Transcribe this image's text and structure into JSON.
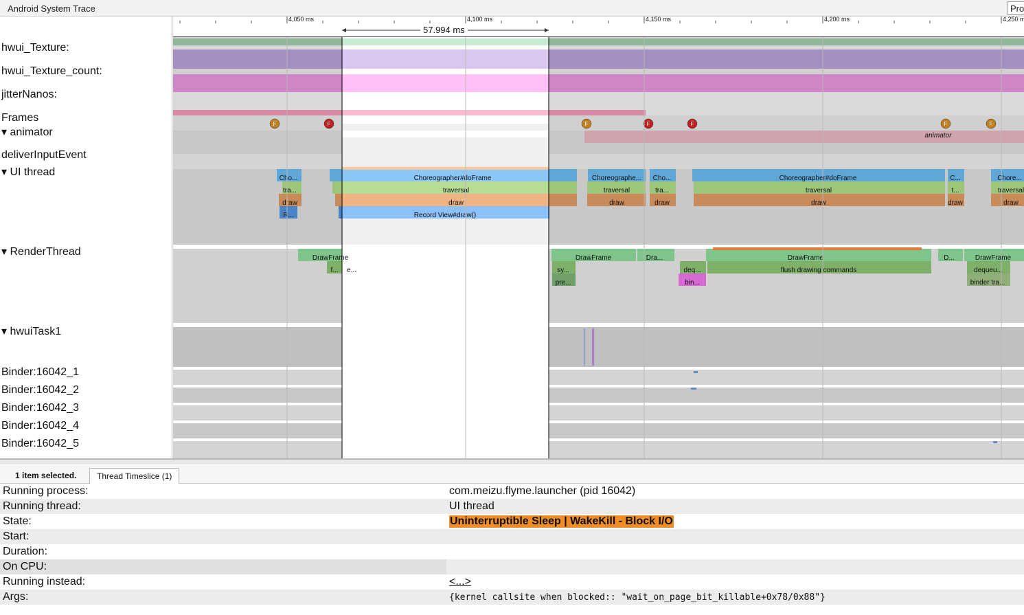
{
  "app": {
    "title": "Android System Trace",
    "pro_button": "Pro"
  },
  "ruler": {
    "ticks": [
      "4,050 ms",
      "4,100 ms",
      "4,150 ms",
      "4,200 ms",
      "4,250 ms"
    ],
    "selection_duration": "57.994 ms"
  },
  "tracks": [
    {
      "label": "hwui_Texture:"
    },
    {
      "label": "hwui_Texture_count:"
    },
    {
      "label": "jitterNanos:"
    },
    {
      "label": "Frames"
    },
    {
      "label": "▾  animator"
    },
    {
      "label": "deliverInputEvent"
    },
    {
      "label": "▾  UI thread"
    },
    {
      "label": "▾  RenderThread"
    },
    {
      "label": "▾  hwuiTask1"
    },
    {
      "label": "Binder:16042_1"
    },
    {
      "label": "Binder:16042_2"
    },
    {
      "label": "Binder:16042_3"
    },
    {
      "label": "Binder:16042_4"
    },
    {
      "label": "Binder:16042_5"
    }
  ],
  "frames_marker_letter": "F",
  "animator_slice_label": "animator",
  "slices": [
    "Cho...",
    "tra...",
    "draw",
    "R...",
    "Choreographer#doFrame",
    "traversal",
    "draw",
    "Record View#draw()",
    "Choreographe...",
    "traversal",
    "draw",
    "Cho...",
    "tra...",
    "draw",
    "Choreographer#doFrame",
    "traversal",
    "draw",
    "C...",
    "t...",
    "draw",
    "Chore...",
    "traversal",
    "draw",
    "DrawFrame",
    "f...",
    "e...",
    "DrawFrame",
    "sy...",
    "pre...",
    "Dra...",
    "deq...",
    "bin...",
    "DrawFrame",
    "flush drawing commands",
    "D...",
    "DrawFrame",
    "dequeu...",
    "binder tra..."
  ],
  "colors": {
    "selection_band": "#ffffff",
    "running_state": "#f08c28",
    "track_bg_a": "#d8d8d8",
    "track_bg_b": "#cccccc"
  },
  "details": {
    "selected_count": "1 item selected.",
    "tab": "Thread Timeslice (1)",
    "rows": [
      {
        "label": "Running process:",
        "value": "com.meizu.flyme.launcher (pid 16042)"
      },
      {
        "label": "Running thread:",
        "value": "UI thread"
      },
      {
        "label": "State:",
        "value": "Uninterruptible Sleep | WakeKill - Block I/O"
      },
      {
        "label": "Start:",
        "value": ""
      },
      {
        "label": "Duration:",
        "value": ""
      },
      {
        "label": "On CPU:",
        "value": ""
      },
      {
        "label": "Running instead:",
        "value": "<...>"
      },
      {
        "label": "Args:",
        "value": "{kernel callsite when blocked:: \"wait_on_page_bit_killable+0x78/0x88\"}"
      }
    ]
  }
}
